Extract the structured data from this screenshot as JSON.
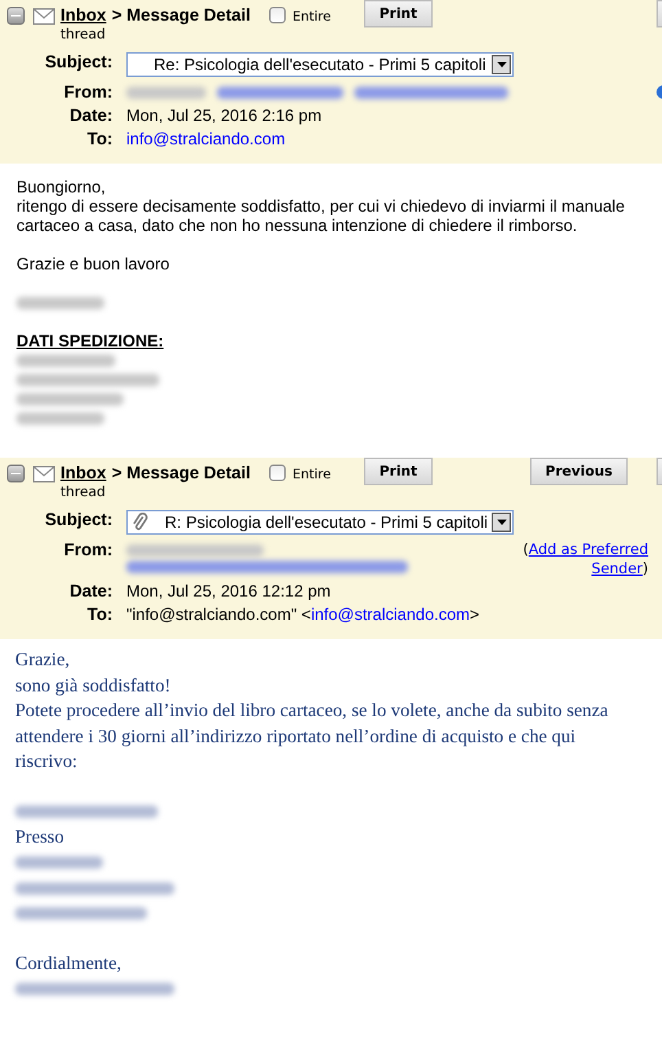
{
  "messages": [
    {
      "kind": "plain",
      "breadcrumb": {
        "link": "Inbox",
        "rest": "> Message Detail",
        "sub": "thread"
      },
      "entire": {
        "label": "Entire",
        "checked": false
      },
      "buttons": [
        "Print"
      ],
      "subject": {
        "label": "Subject:",
        "value": "Re: Psicologia dell'esecutato - Primi 5 capitoli",
        "attachment": false
      },
      "from": {
        "label": "From:",
        "parts": [
          {
            "kind": "redacted"
          },
          {
            "kind": "redacted_link"
          },
          {
            "kind": "redacted_link"
          }
        ]
      },
      "date": {
        "label": "Date:",
        "value": "Mon, Jul 25, 2016 2:16 pm"
      },
      "to": {
        "label": "To:",
        "link": "info@stralciando.com"
      },
      "blocks": [
        {
          "lines": [
            {
              "kind": "text",
              "text": "Buongiorno,\nritengo di essere decisamente soddisfatto, per cui vi chiedevo di inviarmi il manuale\ncartaceo a casa, dato che non ho nessuna intenzione di chiedere il rimborso."
            }
          ]
        },
        {
          "lines": [
            {
              "kind": "text",
              "text": "Grazie e buon lavoro"
            }
          ]
        },
        {
          "lines": [
            {
              "kind": "redacted"
            }
          ]
        },
        {
          "lines": [
            {
              "kind": "heading",
              "text": "DATI SPEDIZIONE:"
            },
            {
              "kind": "redacted"
            },
            {
              "kind": "redacted"
            },
            {
              "kind": "redacted"
            },
            {
              "kind": "redacted"
            }
          ]
        }
      ]
    },
    {
      "kind": "html",
      "breadcrumb": {
        "link": "Inbox",
        "rest": "> Message Detail",
        "sub": "thread"
      },
      "entire": {
        "label": "Entire",
        "checked": false
      },
      "buttons": [
        "Print",
        "Previous"
      ],
      "subject": {
        "label": "Subject:",
        "value": "R: Psicologia dell'esecutato - Primi 5 capitoli",
        "attachment": true
      },
      "from": {
        "label": "From:",
        "parts": [
          {
            "kind": "redacted"
          },
          {
            "kind": "redacted_link"
          }
        ],
        "add_sender": {
          "open": "(",
          "link": "Add as Preferred Sender",
          "close": ")"
        }
      },
      "date": {
        "label": "Date:",
        "value": "Mon, Jul 25, 2016 12:12 pm"
      },
      "to": {
        "label": "To:",
        "prefix": "\"info@stralciando.com\" <",
        "link": "info@stralciando.com",
        "suffix": ">"
      },
      "blocks": [
        {
          "lines": [
            {
              "kind": "text",
              "text": "Grazie,\nsono già soddisfatto!\nPotete procedere all’invio del libro cartaceo, se lo volete, anche da subito senza\nattendere i 30 giorni all’indirizzo riportato nell’ordine di acquisto e che qui\nriscrivo:"
            }
          ]
        },
        {
          "lines": [
            {
              "kind": "redacted"
            },
            {
              "kind": "text",
              "text": "Presso"
            },
            {
              "kind": "redacted"
            },
            {
              "kind": "redacted"
            },
            {
              "kind": "redacted"
            }
          ]
        },
        {
          "lines": [
            {
              "kind": "text",
              "text": "Cordialmente,"
            },
            {
              "kind": "redacted"
            }
          ]
        }
      ]
    }
  ]
}
